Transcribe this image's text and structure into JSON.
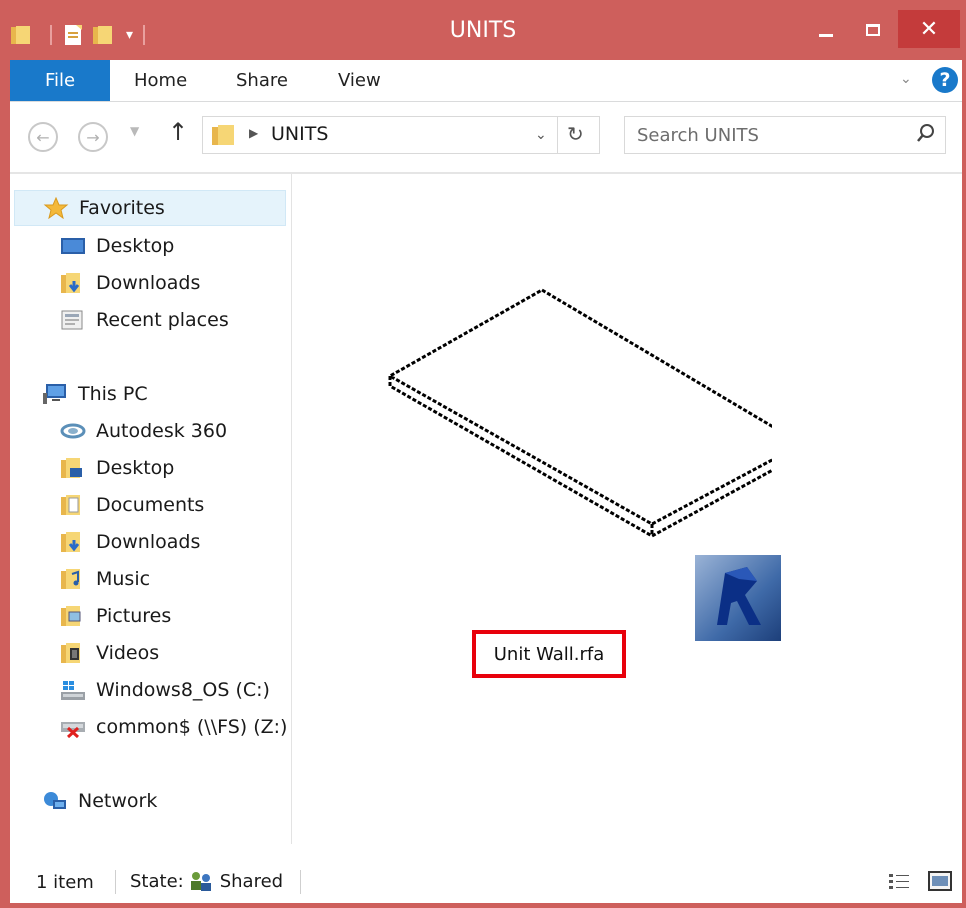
{
  "window": {
    "title": "UNITS",
    "close_glyph": "✕",
    "accent_color": "#ce5f5c"
  },
  "ribbon": {
    "file_label": "File",
    "home_label": "Home",
    "share_label": "Share",
    "view_label": "View",
    "help_glyph": "?"
  },
  "address": {
    "crumb": "UNITS",
    "search_placeholder": "Search UNITS"
  },
  "nav": {
    "favorites": "Favorites",
    "fav_items": [
      "Desktop",
      "Downloads",
      "Recent places"
    ],
    "this_pc": "This PC",
    "pc_items": [
      "Autodesk 360",
      "Desktop",
      "Documents",
      "Downloads",
      "Music",
      "Pictures",
      "Videos",
      "Windows8_OS (C:)",
      "common$ (\\\\FS) (Z:)"
    ],
    "network": "Network"
  },
  "content": {
    "file_name": "Unit Wall.rfa",
    "file_icon": "revit-family-icon"
  },
  "status": {
    "item_count": "1 item",
    "state_label": "State:",
    "state_value": "Shared"
  }
}
